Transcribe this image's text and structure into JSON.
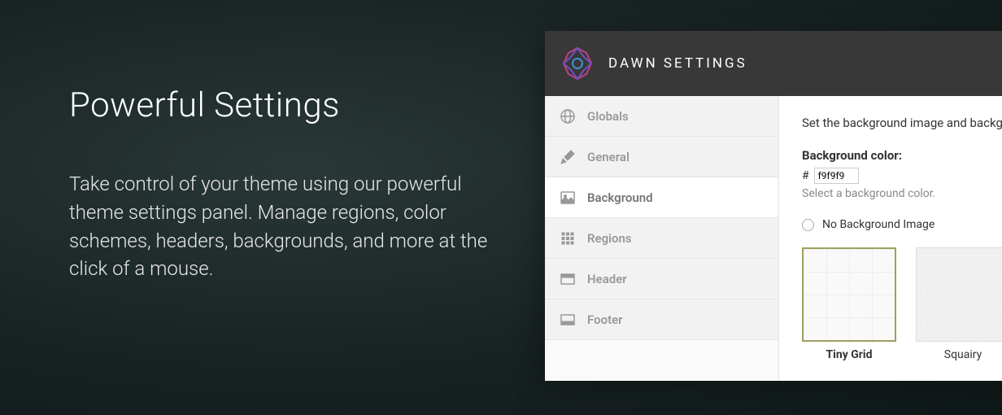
{
  "hero": {
    "title": "Powerful Settings",
    "description": "Take control of your theme using our powerful theme settings panel. Manage regions, color schemes, headers, backgrounds, and more at the click of a mouse."
  },
  "panel": {
    "title": "DAWN SETTINGS"
  },
  "sidebar": {
    "items": [
      {
        "label": "Globals"
      },
      {
        "label": "General"
      },
      {
        "label": "Background"
      },
      {
        "label": "Regions"
      },
      {
        "label": "Header"
      },
      {
        "label": "Footer"
      }
    ]
  },
  "content": {
    "intro": "Set the background image and backg",
    "bg_color_label": "Background color:",
    "hash": "#",
    "bg_color_value": "f9f9f9",
    "bg_color_help": "Select a background color.",
    "no_bg_label": "No Background Image",
    "swatches": [
      {
        "label": "Tiny Grid",
        "selected": true
      },
      {
        "label": "Squairy",
        "selected": false
      }
    ]
  }
}
